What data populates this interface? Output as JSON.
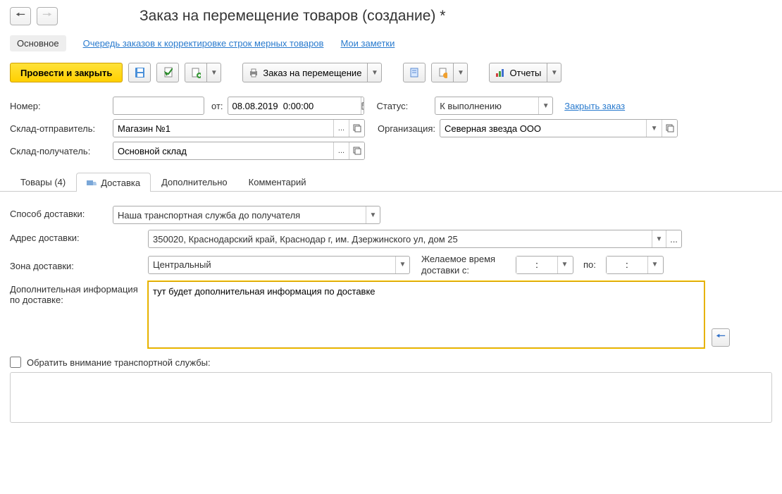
{
  "title": "Заказ на перемещение товаров (создание) *",
  "nav": {
    "main": "Основное",
    "queue": "Очередь заказов к корректировке строк мерных товаров",
    "notes": "Мои заметки"
  },
  "actions": {
    "postClose": "Провести и закрыть",
    "orderMove": "Заказ на перемещение",
    "reports": "Отчеты"
  },
  "fields": {
    "numberLabel": "Номер:",
    "numberValue": "",
    "fromLabel": "от:",
    "date": "08.08.2019  0:00:00",
    "statusLabel": "Статус:",
    "status": "К выполнению",
    "closeOrder": "Закрыть заказ",
    "senderLabel": "Склад-отправитель:",
    "sender": "Магазин №1",
    "orgLabel": "Организация:",
    "org": "Северная звезда ООО",
    "receiverLabel": "Склад-получатель:",
    "receiver": "Основной склад"
  },
  "tabs": {
    "goods": "Товары (4)",
    "delivery": "Доставка",
    "extra": "Дополнительно",
    "comment": "Комментарий"
  },
  "delivery": {
    "methodLabel": "Способ доставки:",
    "method": "Наша транспортная служба до получателя",
    "addressLabel": "Адрес доставки:",
    "address": "350020, Краснодарский край, Краснодар г, им. Дзержинского ул, дом 25",
    "zoneLabel": "Зона доставки:",
    "zone": "Центральный",
    "wishTimeLabel": "Желаемое время доставки с:",
    "toLabel": "по:",
    "timeFrom": ":",
    "timeTo": ":",
    "infoLabel": "Дополнительная информация по доставке:",
    "info": "тут будет дополнительная информация по доставке",
    "attentionLabel": "Обратить внимание транспортной службы:",
    "attentionText": ""
  }
}
